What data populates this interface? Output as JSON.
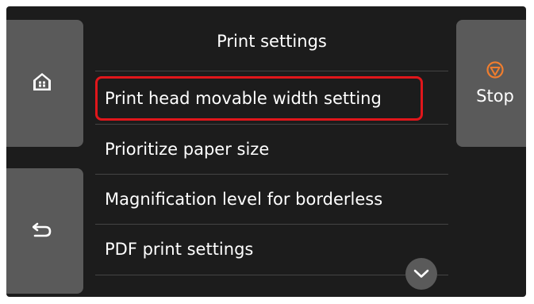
{
  "header": {
    "title": "Print settings"
  },
  "menu": {
    "items": [
      {
        "label": "Print head movable width setting",
        "selected": true
      },
      {
        "label": "Prioritize paper size",
        "selected": false
      },
      {
        "label": "Magnification level for borderless",
        "selected": false
      },
      {
        "label": "PDF print settings",
        "selected": false
      }
    ]
  },
  "buttons": {
    "home_icon": "home-icon",
    "back_icon": "back-arrow-icon",
    "stop_label": "Stop",
    "stop_icon": "stop-icon",
    "scroll_icon": "chevron-down-icon"
  },
  "colors": {
    "background": "#1c1c1c",
    "button": "#5a5a5a",
    "selection_border": "#e0161b",
    "stop_accent": "#f07d2e",
    "text": "#ffffff"
  }
}
